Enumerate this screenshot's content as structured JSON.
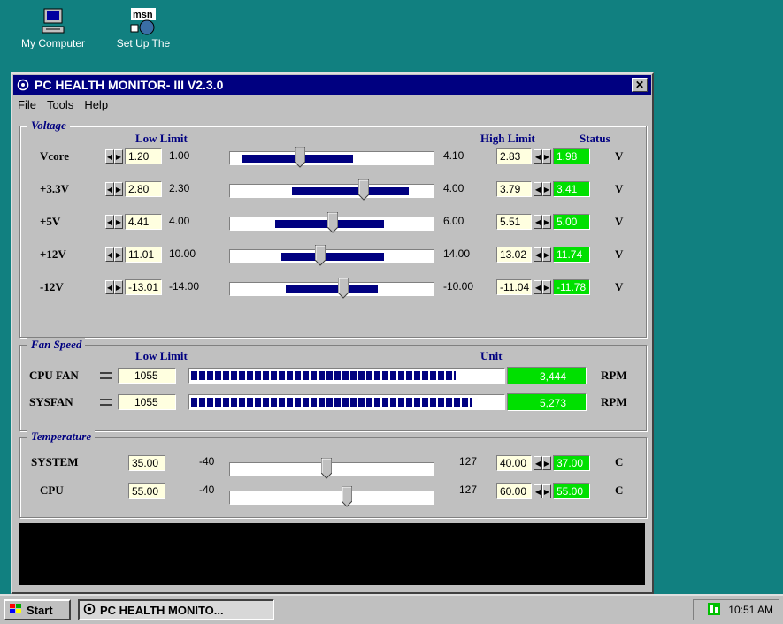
{
  "desktop": {
    "icons": [
      {
        "label": "My Computer"
      },
      {
        "label": "Set Up The"
      }
    ]
  },
  "window": {
    "title": "PC HEALTH MONITOR- III  V2.3.0",
    "close_glyph": "✕",
    "menu": [
      "File",
      "Tools",
      "Help"
    ]
  },
  "voltage": {
    "section_title": "Voltage",
    "low_limit_header": "Low Limit",
    "high_limit_header": "High Limit",
    "status_header": "Status",
    "unit": "V",
    "rows": [
      {
        "label": "Vcore",
        "low": "1.20",
        "min": "1.00",
        "max": "4.10",
        "high": "2.83",
        "status": "1.98",
        "range_start": 0.06,
        "range_end": 0.6,
        "thumb": 0.34
      },
      {
        "label": "+3.3V",
        "low": "2.80",
        "min": "2.30",
        "max": "4.00",
        "high": "3.79",
        "status": "3.41",
        "range_start": 0.3,
        "range_end": 0.87,
        "thumb": 0.65
      },
      {
        "label": "+5V",
        "low": "4.41",
        "min": "4.00",
        "max": "6.00",
        "high": "5.51",
        "status": "5.00",
        "range_start": 0.22,
        "range_end": 0.75,
        "thumb": 0.5
      },
      {
        "label": "+12V",
        "low": "11.01",
        "min": "10.00",
        "max": "14.00",
        "high": "13.02",
        "status": "11.74",
        "range_start": 0.25,
        "range_end": 0.75,
        "thumb": 0.44
      },
      {
        "label": "-12V",
        "low": "-13.01",
        "min": "-14.00",
        "max": "-10.00",
        "high": "-11.04",
        "status": "-11.78",
        "range_start": 0.27,
        "range_end": 0.72,
        "thumb": 0.55
      }
    ]
  },
  "fan": {
    "section_title": "Fan Speed",
    "low_limit_header": "Low Limit",
    "unit_header": "Unit",
    "unit": "RPM",
    "rows": [
      {
        "label": "CPU FAN",
        "low": "1055",
        "value": "3,444",
        "fill": 0.85
      },
      {
        "label": "SYSFAN",
        "low": "1055",
        "value": "5,273",
        "fill": 0.9
      }
    ]
  },
  "temperature": {
    "section_title": "Temperature",
    "unit": "C",
    "rows": [
      {
        "label": "SYSTEM",
        "low": "35.00",
        "min": "-40",
        "max": "127",
        "high": "40.00",
        "status": "37.00",
        "thumb": 0.47
      },
      {
        "label": "CPU",
        "low": "55.00",
        "min": "-40",
        "max": "127",
        "high": "60.00",
        "status": "55.00",
        "thumb": 0.57
      }
    ]
  },
  "taskbar": {
    "start_label": "Start",
    "task_label": "PC HEALTH MONITO...",
    "clock": "10:51 AM"
  }
}
